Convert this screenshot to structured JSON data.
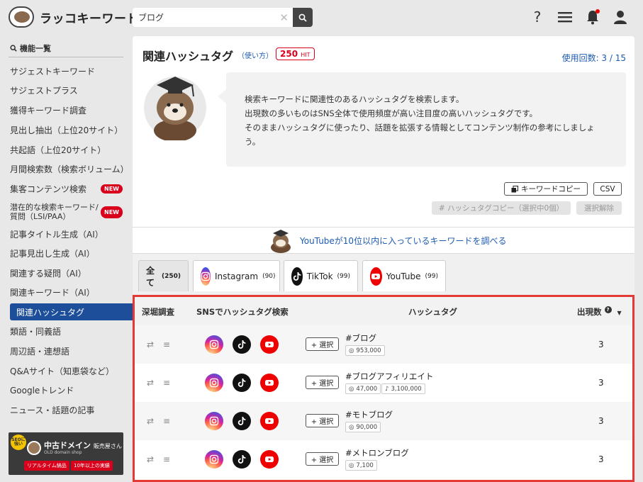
{
  "app": {
    "name": "ラッコキーワード"
  },
  "search": {
    "value": "ブログ"
  },
  "sidebar": {
    "title": "機能一覧",
    "items": [
      {
        "label": "サジェストキーワード"
      },
      {
        "label": "サジェストプラス"
      },
      {
        "label": "獲得キーワード調査"
      },
      {
        "label": "見出し抽出（上位20サイト）"
      },
      {
        "label": "共起語（上位20サイト）"
      },
      {
        "label": "月間検索数（検索ボリューム）"
      },
      {
        "label": "集客コンテンツ検索",
        "badge": "NEW"
      },
      {
        "label_line1": "潜在的な検索キーワード/",
        "label_line2": "質問（LSI/PAA）",
        "badge": "NEW"
      },
      {
        "label": "記事タイトル生成（AI）"
      },
      {
        "label": "記事見出し生成（AI）"
      },
      {
        "label": "関連する疑問（AI）"
      },
      {
        "label": "関連キーワード（AI）"
      },
      {
        "label": "関連ハッシュタグ",
        "active": true
      },
      {
        "label": "類語・同義語"
      },
      {
        "label": "周辺語・連想語"
      },
      {
        "label": "Q&Aサイト（知恵袋など）"
      },
      {
        "label": "Googleトレンド"
      },
      {
        "label": "ニュース・話題の記事"
      }
    ],
    "banner": {
      "seo_badge": "SEOに強い",
      "title": "中古ドメイン",
      "title_suffix": "販売屋さん",
      "subtitle": "OLD domain shop",
      "tag1": "リアルタイム納品",
      "tag2": "10年以上の実績"
    }
  },
  "main": {
    "title": "関連ハッシュタグ",
    "usage_link": "（使い方）",
    "hit_count": "250",
    "hit_unit": "HIT",
    "usage_label": "使用回数: 3 / 15",
    "description": [
      "検索キーワードに関連性のあるハッシュタグを検索します。",
      "出現数の多いものはSNS全体で使用頻度が高い注目度の高いハッシュタグです。",
      "そのままハッシュタグに使ったり、話題を拡張する情報としてコンテンツ制作の参考にしましょ",
      "う。"
    ],
    "buttons": {
      "copy_keywords": "キーワードコピー",
      "csv": "CSV",
      "copy_hashtags": "# ハッシュタグコピー（選択中0個）",
      "deselect": "選択解除"
    },
    "youtube_promo": "YouTubeが10位以内に入っているキーワードを調べる",
    "tabs": [
      {
        "label": "全て",
        "count": "(250)"
      },
      {
        "label": "Instagram",
        "count": "(90)"
      },
      {
        "label": "TikTok",
        "count": "(99)"
      },
      {
        "label": "YouTube",
        "count": "(99)"
      }
    ],
    "table": {
      "headers": {
        "research": "深堀調査",
        "sns": "SNSでハッシュタグ検索",
        "hashtag": "ハッシュタグ",
        "count": "出現数"
      },
      "select_label": "+ 選択",
      "rows": [
        {
          "tag": "#ブログ",
          "instagram": "953,000",
          "tiktok": null,
          "count": "3"
        },
        {
          "tag": "#ブログアフィリエイト",
          "instagram": "47,000",
          "tiktok": "3,100,000",
          "count": "3"
        },
        {
          "tag": "#モトブログ",
          "instagram": "90,000",
          "tiktok": null,
          "count": "3"
        },
        {
          "tag": "#メトロンブログ",
          "instagram": "7,100",
          "tiktok": null,
          "count": "3"
        }
      ]
    }
  },
  "colors": {
    "accent": "#1d4e9a",
    "link": "#1d5bb0",
    "highlight_border": "#e53935",
    "badge_red": "#d9001b"
  }
}
